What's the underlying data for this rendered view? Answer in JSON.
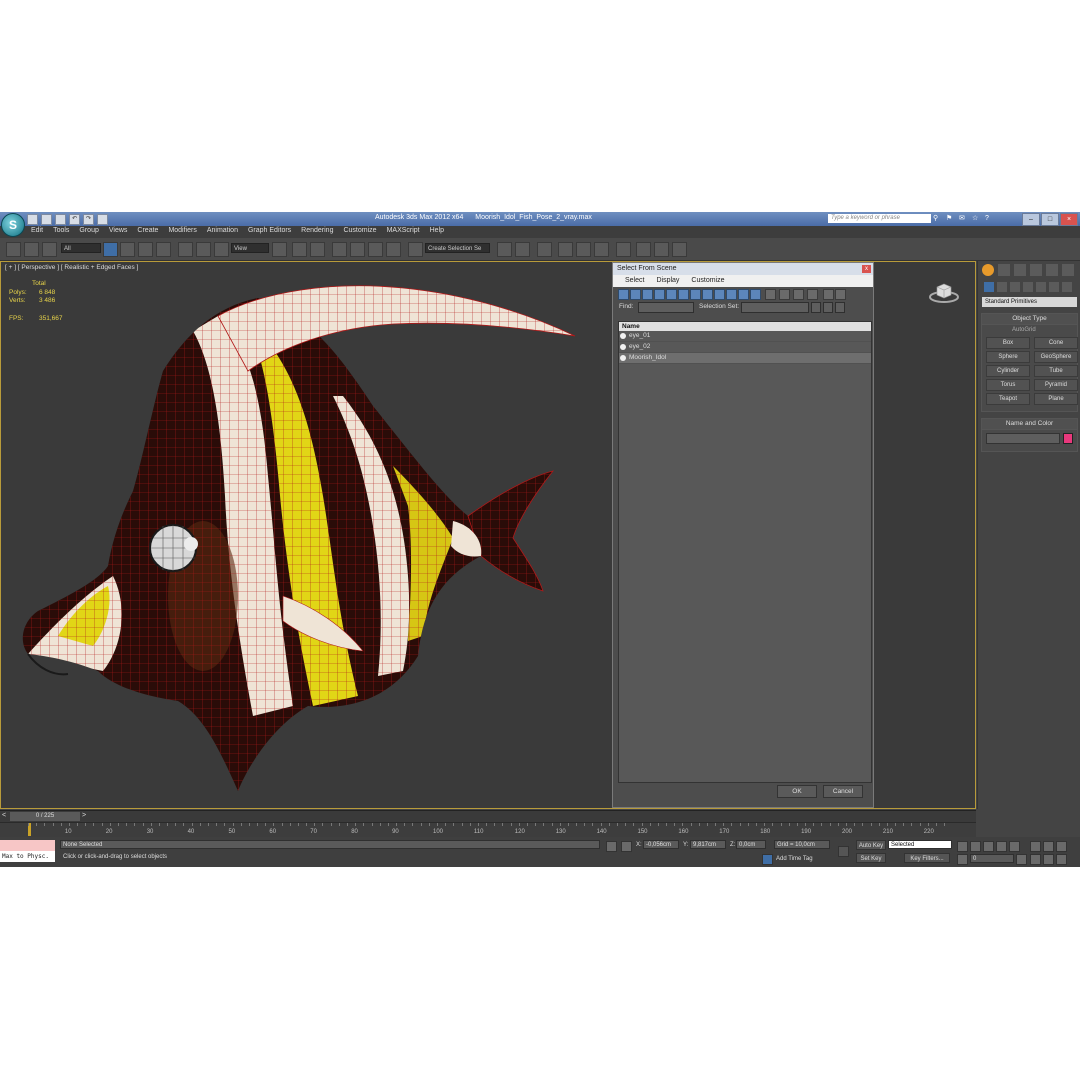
{
  "app": {
    "logo": "S",
    "title_app": "Autodesk 3ds Max  2012 x64",
    "title_file": "Moorish_Idol_Fish_Pose_2_vray.max",
    "search_placeholder": "Type a keyword or phrase"
  },
  "menu": [
    "Edit",
    "Tools",
    "Group",
    "Views",
    "Create",
    "Modifiers",
    "Animation",
    "Graph Editors",
    "Rendering",
    "Customize",
    "MAXScript",
    "Help"
  ],
  "toolbar": {
    "filter_select": "All",
    "view_select": "View",
    "selection_set": "Create Selection Se"
  },
  "viewport": {
    "label": "[ + ] [ Perspective ] [ Realistic + Edged Faces ]",
    "stats_total": "Total",
    "polys_label": "Polys:",
    "polys_value": "6 848",
    "verts_label": "Verts:",
    "verts_value": "3 486",
    "fps_label": "FPS:",
    "fps_value": "351,667"
  },
  "command_panel": {
    "dropdown": "Standard Primitives",
    "object_type_title": "Object Type",
    "autogrid": "AutoGrid",
    "primitives": [
      "Box",
      "Cone",
      "Sphere",
      "GeoSphere",
      "Cylinder",
      "Tube",
      "Torus",
      "Pyramid",
      "Teapot",
      "Plane"
    ],
    "name_color_title": "Name and Color",
    "swatch_color": "#e8387c"
  },
  "dialog": {
    "title": "Select From Scene",
    "close": "x",
    "menu": [
      "Select",
      "Display",
      "Customize"
    ],
    "find_label": "Find:",
    "selection_set_label": "Selection Set:",
    "list_header": "Name",
    "items": [
      "eye_01",
      "eye_02",
      "Moorish_Idol"
    ],
    "ok": "OK",
    "cancel": "Cancel"
  },
  "timeline": {
    "frame": "0 / 225",
    "ticks": [
      "10",
      "20",
      "30",
      "40",
      "50",
      "60",
      "70",
      "80",
      "90",
      "100",
      "110",
      "120",
      "130",
      "140",
      "150",
      "160",
      "170",
      "180",
      "190",
      "200",
      "210",
      "220"
    ]
  },
  "status": {
    "maxscript": "Max to Physc.",
    "selected": "None Selected",
    "prompt": "Click or click-and-drag to select objects",
    "x_label": "X:",
    "x_value": "-0,056cm",
    "y_label": "Y:",
    "y_value": "9,817cm",
    "z_label": "Z:",
    "z_value": "0,0cm",
    "grid": "Grid = 10,0cm",
    "add_time_tag": "Add Time Tag",
    "auto_key": "Auto Key",
    "key_mode": "Selected",
    "set_key": "Set Key",
    "key_filters": "Key Filters...",
    "current_frame": "0"
  }
}
